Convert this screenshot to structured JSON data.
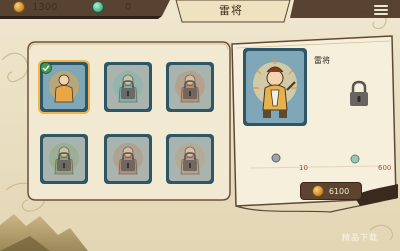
{
  "resources": {
    "coins": "1300",
    "gems": "0"
  },
  "header": {
    "title": "雷将"
  },
  "cards": [
    {
      "name": "雷将",
      "selected": true,
      "owned": true,
      "theme": "#e8a744"
    },
    {
      "name": "locked-hero-2",
      "selected": false,
      "owned": false,
      "theme": "#5fb3a8"
    },
    {
      "name": "locked-hero-3",
      "selected": false,
      "owned": false,
      "theme": "#c77a44"
    },
    {
      "name": "locked-hero-4",
      "selected": false,
      "owned": false,
      "theme": "#7fa15a"
    },
    {
      "name": "locked-hero-5",
      "selected": false,
      "owned": false,
      "theme": "#b87a54"
    },
    {
      "name": "locked-hero-6",
      "selected": false,
      "owned": false,
      "theme": "#c9966a"
    }
  ],
  "detail": {
    "name": "雷将",
    "stat_left": "10",
    "stat_right": "600",
    "price": "6100"
  },
  "watermark": "精品下载",
  "colors": {
    "panel": "#f4ecd8",
    "panel_border": "#5e4a34",
    "card_frame": "#2f5666",
    "selected_outline": "#f0b448",
    "header_bar": "#5a4230"
  },
  "icons": {
    "coin": "gold-coin-icon",
    "gem": "jade-gem-icon",
    "lock": "padlock-icon",
    "check": "green-check-icon",
    "menu": "hamburger-menu-icon"
  }
}
